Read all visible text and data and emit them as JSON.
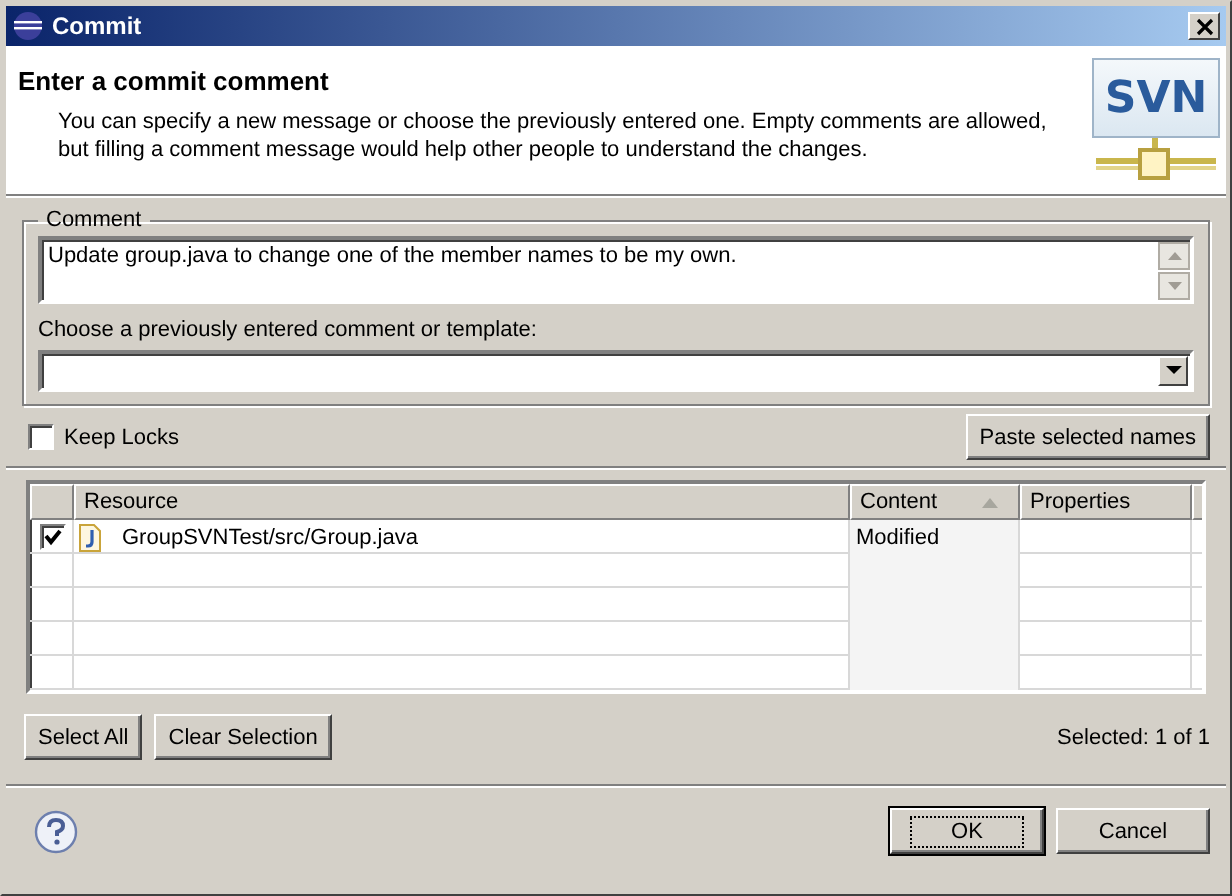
{
  "window": {
    "title": "Commit"
  },
  "header": {
    "title": "Enter a commit comment",
    "description": "You can specify a new message or choose the previously entered one. Empty comments are allowed, but filling a comment message would help other people to understand the changes.",
    "logo": "SVN"
  },
  "comment": {
    "group_label": "Comment",
    "value": "Update group.java to change one of the member names to be my own."
  },
  "template": {
    "label": "Choose a previously entered comment or template:"
  },
  "keep_locks": {
    "label": "Keep Locks",
    "checked": false
  },
  "paste_button": "Paste selected names",
  "table": {
    "columns": [
      {
        "label": "Resource",
        "sorted": false
      },
      {
        "label": "Content",
        "sorted": true
      },
      {
        "label": "Properties",
        "sorted": false
      }
    ],
    "rows": [
      {
        "checked": true,
        "resource": "GroupSVNTest/src/Group.java",
        "content": "Modified"
      }
    ]
  },
  "selection_buttons": [
    "Select All",
    "Clear Selection"
  ],
  "selected_count": "Selected: 1 of 1",
  "buttons": [
    {
      "label": "OK",
      "default": true
    },
    {
      "label": "Cancel",
      "default": false
    }
  ]
}
